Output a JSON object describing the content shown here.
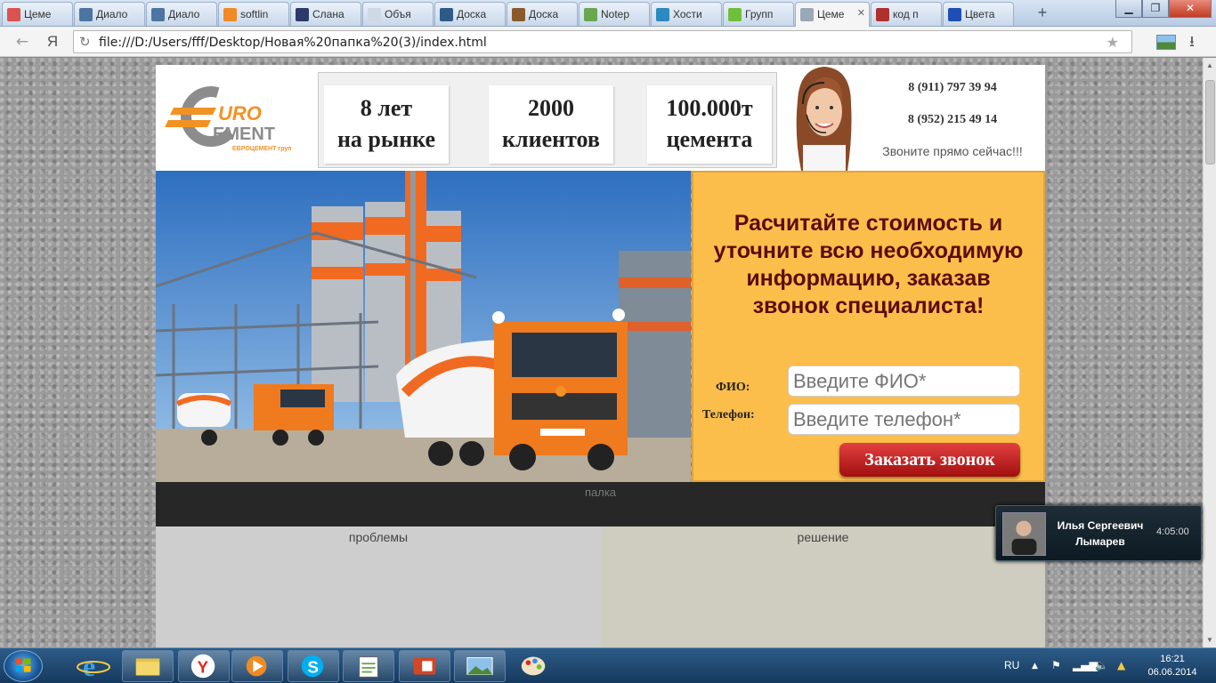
{
  "browser": {
    "tabs": [
      {
        "label": "Цеме",
        "icon": "colorful-dots-icon",
        "color": "#d9534f",
        "active": false
      },
      {
        "label": "Диало",
        "icon": "vk-icon",
        "color": "#4c75a3",
        "active": false
      },
      {
        "label": "Диало",
        "icon": "vk-icon",
        "color": "#4c75a3",
        "active": false
      },
      {
        "label": "softlin",
        "icon": "k-letter-icon",
        "color": "#f08a24",
        "active": false
      },
      {
        "label": "Слана",
        "icon": "w-letter-icon",
        "color": "#2b3a6b",
        "active": false
      },
      {
        "label": "Объя",
        "icon": "blank-page-icon",
        "color": "#cfd9e6",
        "active": false
      },
      {
        "label": "Доска",
        "icon": "anchor-icon",
        "color": "#2d5b87",
        "active": false
      },
      {
        "label": "Доска",
        "icon": "grid-icon",
        "color": "#8a5a2b",
        "active": false
      },
      {
        "label": "Notep",
        "icon": "notepad-icon",
        "color": "#6aa84f",
        "active": false
      },
      {
        "label": "Хости",
        "icon": "chevron-icon",
        "color": "#2b8ac0",
        "active": false
      },
      {
        "label": "Групп",
        "icon": "green-circle-icon",
        "color": "#6fbf3b",
        "active": false
      },
      {
        "label": "Цеме",
        "icon": "page-icon",
        "color": "#9aa8b8",
        "active": true
      },
      {
        "label": "код п",
        "icon": "image-icon",
        "color": "#b03030",
        "active": false
      },
      {
        "label": "Цвета",
        "icon": "mountain-icon",
        "color": "#1f4fb5",
        "active": false
      }
    ],
    "new_tab": "+",
    "back_icon": "←",
    "yandex_glyph": "Я",
    "reload_icon": "↻",
    "url": "file:///D:/Users/fff/Desktop/Новая%20папка%20(3)/index.html",
    "star_icon": "★",
    "download_icon": "⭳",
    "win_minimize": "▁",
    "win_maximize": "❐",
    "win_close": "✕"
  },
  "site": {
    "logo": {
      "euro": "URO",
      "cement": "EMENT",
      "sub": "ЕВРОЦЕМЕНТ груп",
      "accent": "#f39224",
      "grey": "#8c8c8c"
    },
    "stats": [
      {
        "line1": "8 лет",
        "line2": "на рынке"
      },
      {
        "line1": "2000",
        "line2": "клиентов"
      },
      {
        "line1": "100.000т",
        "line2": "цемента"
      }
    ],
    "phones": [
      "8 (911) 797 39 94",
      "8 (952) 215 49 14"
    ],
    "call_now": "Звоните прямо сейчас!!!",
    "form": {
      "title": "Расчитайте стоимость и уточните всю необходимую информацию, заказав звонок специалиста!",
      "name_label": "ФИО:",
      "name_placeholder": "Введите ФИО*",
      "phone_label": "Телефон:",
      "phone_placeholder": "Введите телефон*",
      "submit_label": "Заказать звонок",
      "bg_color": "#fcbe4b",
      "button_color": "#c41e1e"
    },
    "bar_text": "палка",
    "problems_title": "проблемы",
    "solution_title": "решение"
  },
  "notification": {
    "name": "Илья Сергеевич Лымарев",
    "time": "4:05:00"
  },
  "taskbar": {
    "apps": [
      "internet-explorer-icon",
      "file-explorer-icon",
      "yandex-browser-icon",
      "media-player-icon",
      "skype-icon",
      "notepad-plus-icon",
      "powerpoint-icon",
      "photo-viewer-icon",
      "paint-icon"
    ],
    "language": "RU",
    "time": "16:21",
    "date": "06.06.2014"
  }
}
